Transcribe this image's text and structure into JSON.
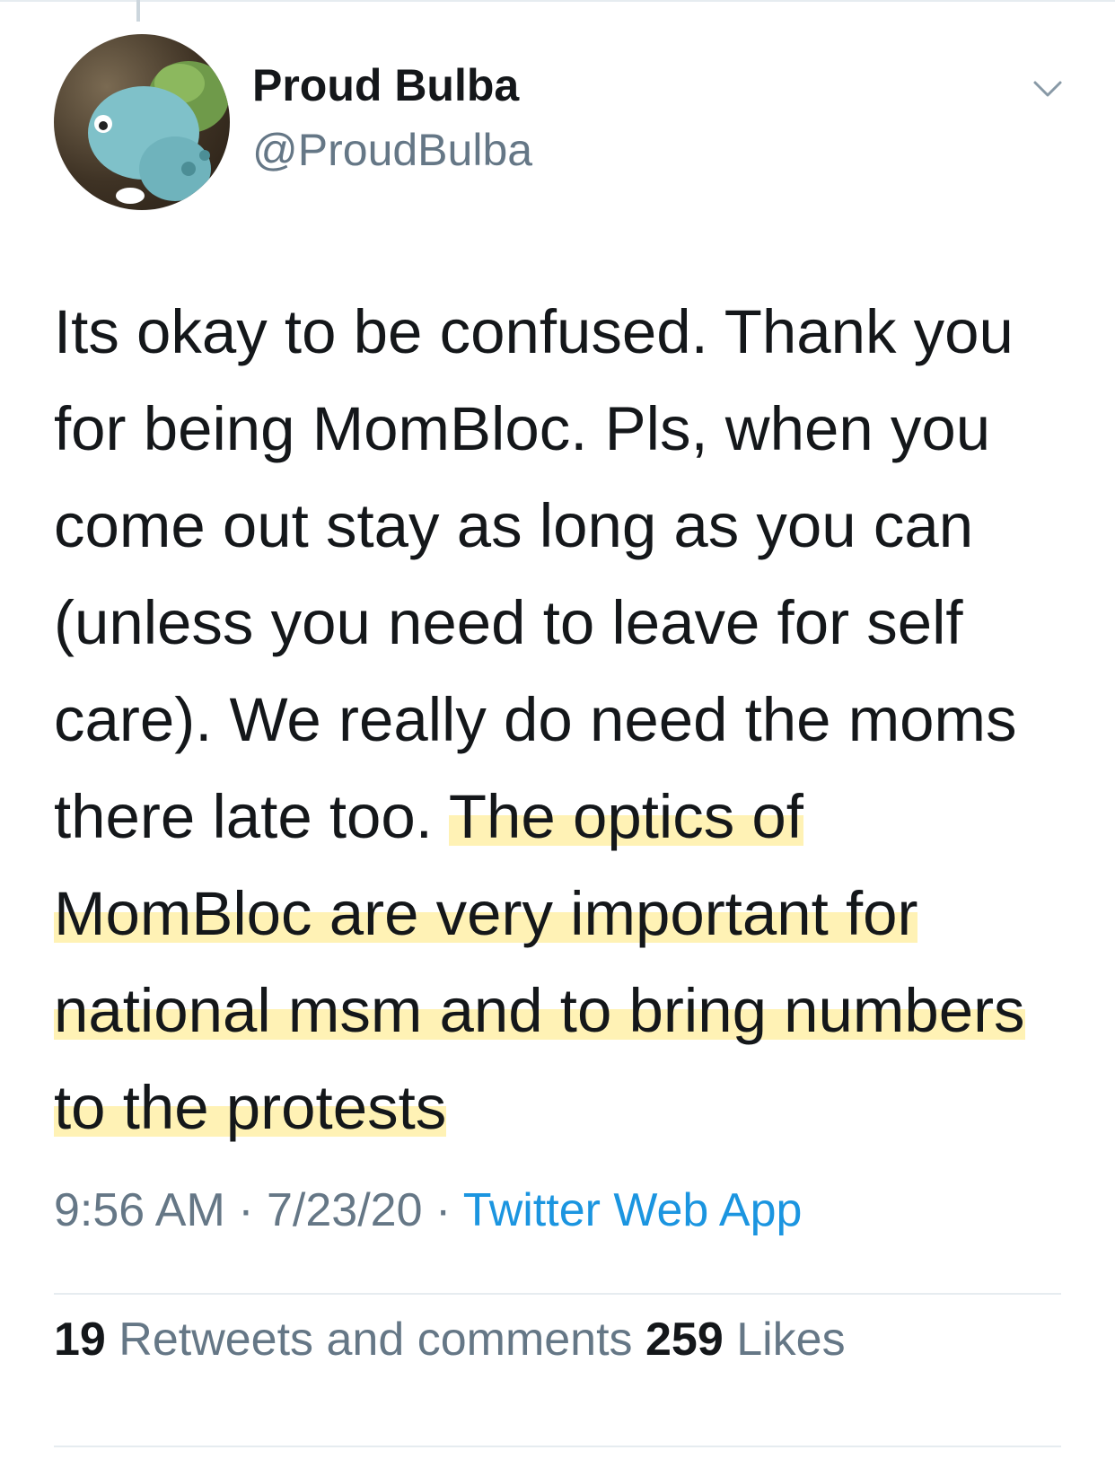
{
  "tweet": {
    "author": {
      "name": "Proud Bulba",
      "handle": "@ProudBulba"
    },
    "text_plain": "Its okay to be confused. Thank you for being MomBloc. Pls, when you come out stay as long as you can (unless you need to leave for self care). We really do need the moms there late too. ",
    "text_highlighted": "The optics of MomBloc are very important for national msm and to bring numbers to the protests",
    "time": "9:56 AM",
    "separator": " · ",
    "date": "7/23/20",
    "source": "Twitter Web App",
    "retweets_count": "19",
    "retweets_label": " Retweets and comments ",
    "likes_count": "259",
    "likes_label": " Likes"
  },
  "colors": {
    "text": "#14171a",
    "secondary": "#657786",
    "link": "#1b95e0",
    "highlight": "#ffe778",
    "divider": "#e6ecf0"
  },
  "icons": {
    "menu": "chevron-down-icon"
  }
}
